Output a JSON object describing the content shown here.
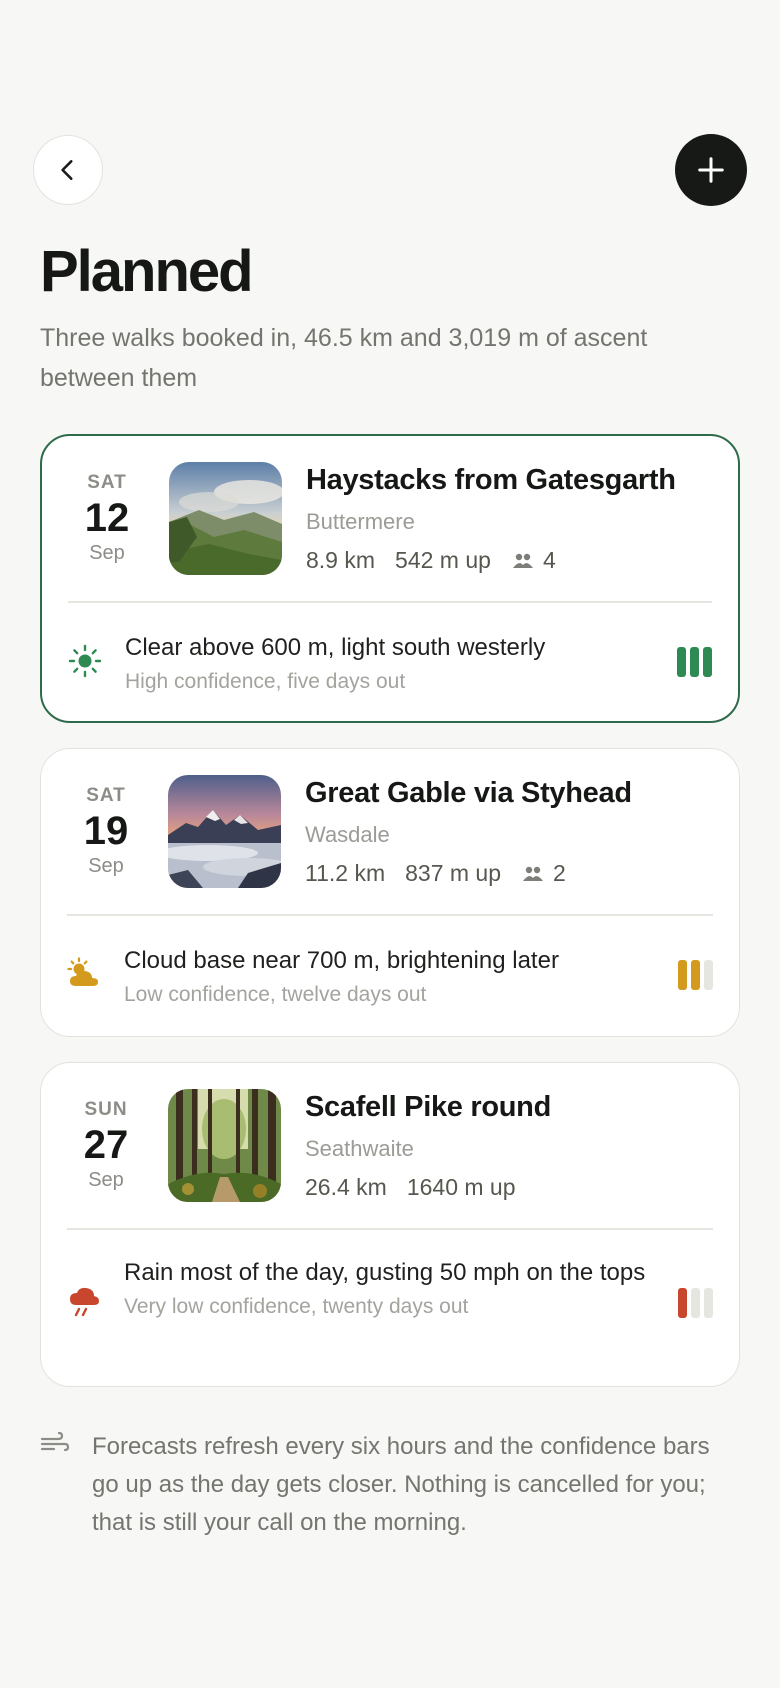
{
  "header": {
    "back_icon": "chevron-left-icon",
    "add_icon": "plus-icon",
    "title": "Planned",
    "subtitle": "Three walks booked in, 46.5 km and 3,019 m of ascent between them"
  },
  "walks": [
    {
      "dow": "SAT",
      "day": "12",
      "month": "Sep",
      "name": "Haystacks from Gatesgarth",
      "place": "Buttermere",
      "distance": "8.9 km",
      "ascent": "542 m up",
      "people": "4",
      "image_icon": "mountain-landscape-image",
      "forecast": {
        "icon": "sun-icon",
        "summary": "Clear above 600 m, light south westerly",
        "confidence": "High confidence, five days out",
        "confidence_level": 3,
        "color": "#2e8a52"
      }
    },
    {
      "dow": "SAT",
      "day": "19",
      "month": "Sep",
      "name": "Great Gable via Styhead",
      "place": "Wasdale",
      "distance": "11.2 km",
      "ascent": "837 m up",
      "people": "2",
      "image_icon": "snowy-peaks-image",
      "forecast": {
        "icon": "partly-cloudy-icon",
        "summary": "Cloud base near 700 m, brightening later",
        "confidence": "Low confidence, twelve days out",
        "confidence_level": 2,
        "color": "#d49a1e"
      }
    },
    {
      "dow": "SUN",
      "day": "27",
      "month": "Sep",
      "name": "Scafell Pike round",
      "place": "Seathwaite",
      "distance": "26.4 km",
      "ascent": "1640 m up",
      "people": "",
      "image_icon": "forest-path-image",
      "forecast": {
        "icon": "rain-cloud-icon",
        "summary": "Rain most of the day, gusting 50 mph on the tops",
        "confidence": "Very low confidence, twenty days out",
        "confidence_level": 1,
        "color": "#c8462e"
      }
    }
  ],
  "footnote": {
    "icon": "wind-icon",
    "text": "Forecasts refresh every six hours and the confidence bars go up as the day gets closer. Nothing is cancelled for you; that is still your call on the morning."
  },
  "colors": {
    "background": "#f7f7f5",
    "active_border": "#2e6b4a",
    "bar_empty": "#e6e6e0"
  }
}
